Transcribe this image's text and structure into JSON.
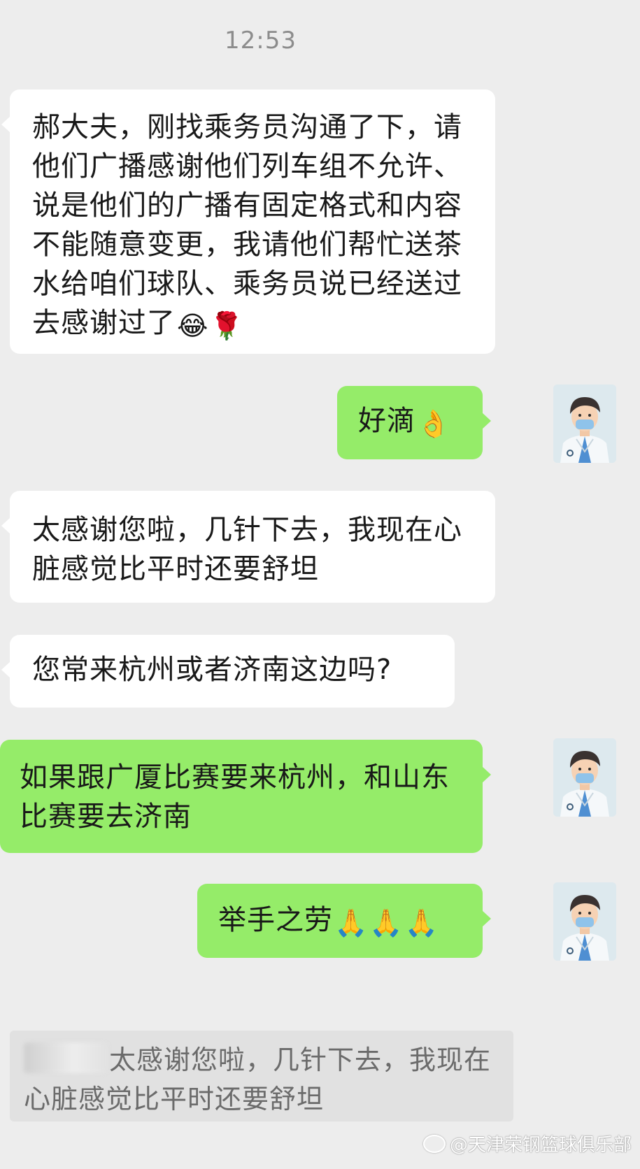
{
  "chat": {
    "timestamp": "12:53",
    "messages": [
      {
        "text": "郝大夫，刚找乘务员沟通了下，请他们广播感谢他们列车组不允许、说是他们的广播有固定格式和内容不能随意变更，我请他们帮忙送茶水给咱们球队、乘务员说已经送过去感谢过了",
        "emojis": [
          "😂",
          "🌹"
        ]
      },
      {
        "text": "好滴",
        "emojis": [
          "👌"
        ]
      },
      {
        "text": "太感谢您啦，几针下去，我现在心脏感觉比平时还要舒坦",
        "emojis": []
      },
      {
        "text": "您常来杭州或者济南这边吗?",
        "emojis": []
      },
      {
        "text": "如果跟广厦比赛要来杭州，和山东比赛要去济南",
        "emojis": []
      },
      {
        "text": "举手之劳",
        "emojis": [
          "🙏",
          "🙏",
          "🙏"
        ]
      }
    ],
    "quote": {
      "text": "太感谢您啦，几针下去，我现在心脏感觉比平时还要舒坦"
    }
  },
  "watermark": "@天津荣钢篮球俱乐部",
  "colors": {
    "background": "#ededed",
    "incoming_bubble": "#ffffff",
    "outgoing_bubble": "#95ec69",
    "text": "#191919",
    "timestamp": "#8c8c8c"
  },
  "icons": [
    "doctor-avatar-icon",
    "weibo-icon"
  ]
}
